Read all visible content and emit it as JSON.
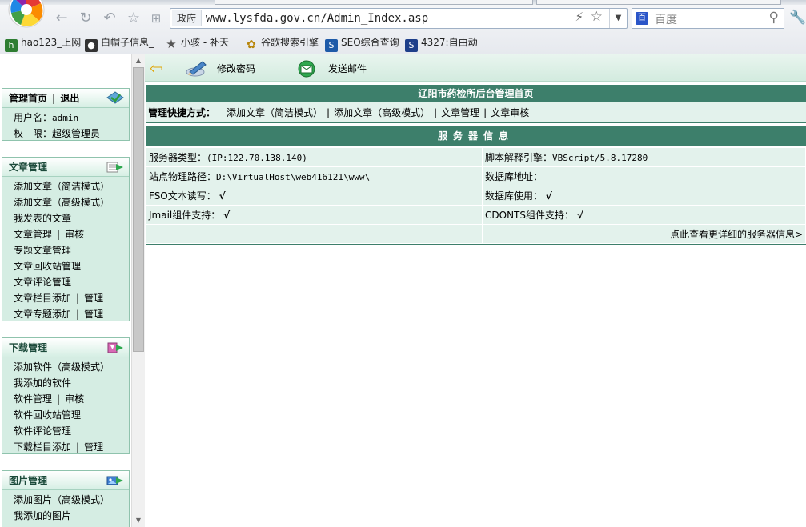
{
  "browser": {
    "url_tag": "政府",
    "url": "www.lysfda.gov.cn/Admin_Index.asp",
    "search_placeholder": "百度",
    "search_engine_icon": "baidu-icon",
    "bookmarks": [
      {
        "label": "hao123_上网",
        "icon": "hao123-icon",
        "color": "#2e7d32"
      },
      {
        "label": "白帽子信息_",
        "icon": "mac-icon",
        "color": "#333333"
      },
      {
        "label": "小骇 - 补天",
        "icon": "star-icon",
        "color": "#555555"
      },
      {
        "label": "谷歌搜索引擎",
        "icon": "google-icon",
        "color": "#b8860b"
      },
      {
        "label": "SEO综合查询",
        "icon": "seo-icon",
        "color": "#1e5aa8"
      },
      {
        "label": "4327:自由动",
        "icon": "s-icon",
        "color": "#1e3f8a"
      }
    ]
  },
  "sidebar": {
    "home": {
      "home_label": "管理首页",
      "sep": "|",
      "logout_label": "退出"
    },
    "user": {
      "username_label": "用户名：",
      "username": "admin",
      "role_label": "权　限：",
      "role": "超级管理员"
    },
    "article": {
      "title": "文章管理",
      "items": [
        "添加文章（简洁模式）",
        "添加文章（高级模式）",
        "我发表的文章"
      ],
      "manage": "文章管理",
      "audit": "审核",
      "items2": [
        "专题文章管理",
        "文章回收站管理",
        "文章评论管理"
      ],
      "column_add": "文章栏目添加",
      "column_manage": "管理",
      "topic_add": "文章专题添加",
      "topic_manage": "管理",
      "sep": "|"
    },
    "download": {
      "title": "下载管理",
      "items": [
        "添加软件（高级模式）",
        "我添加的软件"
      ],
      "manage": "软件管理",
      "audit": "审核",
      "items2": [
        "软件回收站管理",
        "软件评论管理"
      ],
      "column_add": "下载栏目添加",
      "column_manage": "管理",
      "sep": "|"
    },
    "picture": {
      "title": "图片管理",
      "items": [
        "添加图片（高级模式）",
        "我添加的图片"
      ]
    }
  },
  "main": {
    "toolbar": {
      "change_password": "修改密码",
      "send_mail": "发送邮件"
    },
    "page_title": "辽阳市药检所后台管理首页",
    "quick": {
      "label": "管理快捷方式：",
      "links": [
        "添加文章（简洁模式）",
        "添加文章（高级模式）",
        "文章管理",
        "文章审核"
      ],
      "sep": "|"
    },
    "server_title": "服务器信息",
    "server": {
      "type_label": "服务器类型：",
      "type_value": "(IP:122.70.138.140)",
      "engine_label": "脚本解释引擎：",
      "engine_value": "VBScript/5.8.17280",
      "path_label": "站点物理路径：",
      "path_value": "D:\\VirtualHost\\web416121\\www\\",
      "db_addr_label": "数据库地址：",
      "fso_label": "FSO文本读写：",
      "fso_value": "√",
      "db_use_label": "数据库使用：",
      "db_use_value": "√",
      "jmail_label": "Jmail组件支持：",
      "jmail_value": "√",
      "cdonts_label": "CDONTS组件支持：",
      "cdonts_value": "√",
      "more_link": "点此查看更详细的服务器信息>"
    }
  }
}
